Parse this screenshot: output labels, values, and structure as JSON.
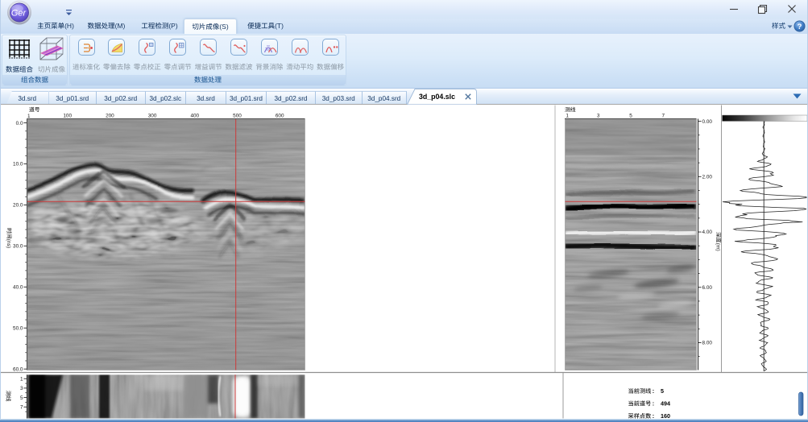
{
  "window": {
    "logo_text": "Ger",
    "minimize_label": "minimize",
    "maximize_label": "restore",
    "close_label": "close"
  },
  "menu_bar": {
    "items": [
      {
        "label": "主页菜单(H)",
        "active": false
      },
      {
        "label": "数据处理(M)",
        "active": false
      },
      {
        "label": "工程检测(P)",
        "active": false
      },
      {
        "label": "切片成像(S)",
        "active": true
      },
      {
        "label": "便捷工具(T)",
        "active": false
      }
    ],
    "style_label": "样式",
    "help_glyph": "?"
  },
  "ribbon": {
    "groups": [
      {
        "label": "组合数据",
        "buttons": [
          {
            "label": "数据组合",
            "icon": "grid-combine",
            "enabled": true
          },
          {
            "label": "切片成像",
            "icon": "slice-cube",
            "enabled": false
          }
        ]
      },
      {
        "label": "数据处理",
        "buttons": [
          {
            "label": "道标准化",
            "icon": "trace-normalize",
            "enabled": false
          },
          {
            "label": "零偏去除",
            "icon": "dc-remove",
            "enabled": false
          },
          {
            "label": "零点校正",
            "icon": "zero-correct",
            "enabled": false
          },
          {
            "label": "零点调节",
            "icon": "zero-adjust",
            "enabled": false
          },
          {
            "label": "增益调节",
            "icon": "gain-adjust",
            "enabled": false
          },
          {
            "label": "数据滤波",
            "icon": "data-filter",
            "enabled": false
          },
          {
            "label": "背景消除",
            "icon": "background-remove",
            "enabled": false
          },
          {
            "label": "滑动平均",
            "icon": "moving-average",
            "enabled": false
          },
          {
            "label": "数据偏移",
            "icon": "data-offset",
            "enabled": false
          }
        ]
      }
    ]
  },
  "tab_bar": {
    "tabs": [
      {
        "label": "3d.srd",
        "active": false
      },
      {
        "label": "3d_p01.srd",
        "active": false
      },
      {
        "label": "3d_p02.srd",
        "active": false
      },
      {
        "label": "3d_p02.slc",
        "active": false
      },
      {
        "label": "3d.srd",
        "active": false
      },
      {
        "label": "3d_p01.srd",
        "active": false
      },
      {
        "label": "3d_p02.srd",
        "active": false
      },
      {
        "label": "3d_p03.srd",
        "active": false
      },
      {
        "label": "3d_p04.srd",
        "active": false
      },
      {
        "label": "3d_p04.slc",
        "active": true,
        "closable": true
      }
    ],
    "overflow_icon": "chevron-down-icon"
  },
  "chart_data": [
    {
      "type": "heatmap",
      "name": "main-bscan",
      "title": "",
      "xlabel": "道号",
      "ylabel": "时间(ns)",
      "x_first_tick": "1",
      "x_ticks": [
        "100",
        "200",
        "300",
        "400",
        "500",
        "600"
      ],
      "y_ticks": [
        "0.0",
        "10.0",
        "20.0",
        "30.0",
        "40.0",
        "50.0",
        "60.0"
      ],
      "xlim": [
        1,
        654
      ],
      "ylim": [
        0,
        61
      ],
      "crosshair": {
        "trace": 494,
        "time_ns": 19.2
      }
    },
    {
      "type": "heatmap",
      "name": "crossline-bscan",
      "xlabel": "测线",
      "ylabel": "深度(m)",
      "x_ticks": [
        "1",
        "3",
        "5",
        "7"
      ],
      "y_ticks": [
        "0.00",
        "2.00",
        "4.00",
        "6.00",
        "8.00"
      ],
      "xlim": [
        1,
        9
      ],
      "ylim": [
        0,
        9
      ],
      "marker_line_depth": 2.9
    },
    {
      "type": "heatmap",
      "name": "time-slice",
      "ylabel": "测线",
      "y_ticks": [
        "1",
        "3",
        "5",
        "7"
      ],
      "marker_trace": 494
    },
    {
      "type": "line",
      "name": "trace-wiggle",
      "description": "single trace amplitude vs depth with grayscale colorbar"
    }
  ],
  "status_panel": {
    "rows": [
      {
        "label": "当前测线",
        "separator": ":",
        "value": "5"
      },
      {
        "label": "当前道号",
        "separator": ":",
        "value": "494"
      },
      {
        "label": "采样点数",
        "separator": ":",
        "value": "160"
      }
    ]
  },
  "colors": {
    "accent_blue": "#2c6cb5",
    "crosshair_red": "#cc3b3b",
    "ribbon_text_blue": "#2a6199",
    "disabled_gray": "#95a1ad"
  }
}
